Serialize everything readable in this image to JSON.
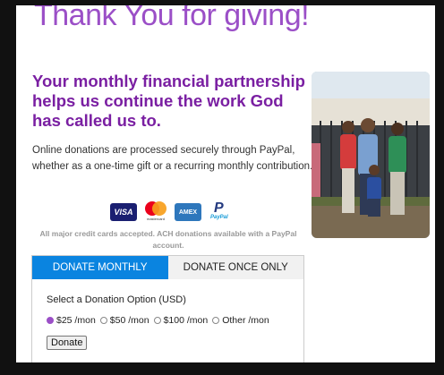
{
  "page": {
    "title": "Thank You for giving!",
    "headline": "Your monthly financial partnership helps us continue the work God has called us to.",
    "body": "Online donations are processed securely through PayPal, whether as a one-time gift or a recurring monthly contribution.",
    "note": "All major credit cards accepted. ACH donations available with a PayPal account."
  },
  "cards": {
    "visa": "VISA",
    "mastercard": "mastercard",
    "amex": "AMEX",
    "paypal": "PayPal"
  },
  "tabs": {
    "monthly": "DONATE MONTHLY",
    "once": "DONATE ONCE ONLY",
    "active": "monthly"
  },
  "form": {
    "option_label": "Select a Donation Option (USD)",
    "options": [
      "$25 /mon",
      "$50 /mon",
      "$100 /mon",
      "Other /mon"
    ],
    "selected": "$25 /mon",
    "button": "Donate"
  },
  "colors": {
    "title": "#9b4fc7",
    "headline": "#7a1fa2",
    "active_tab": "#0a84e0"
  }
}
